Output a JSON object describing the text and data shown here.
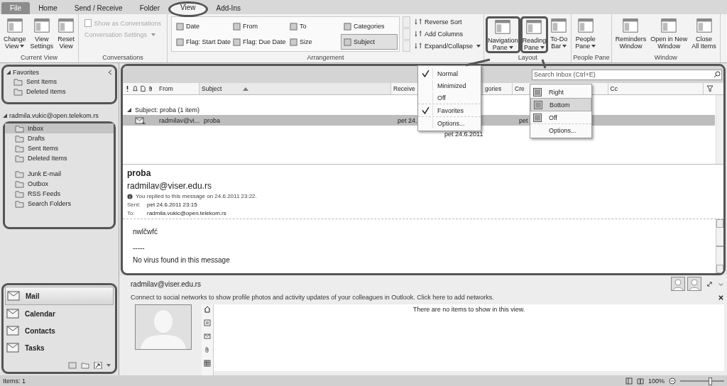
{
  "tabs": [
    {
      "label": "File",
      "kind": "file",
      "selected": false,
      "annotated": false
    },
    {
      "label": "Home",
      "kind": "tab",
      "selected": false,
      "annotated": false
    },
    {
      "label": "Send / Receive",
      "kind": "tab",
      "selected": false,
      "annotated": false
    },
    {
      "label": "Folder",
      "kind": "tab",
      "selected": false,
      "annotated": false
    },
    {
      "label": "View",
      "kind": "tab",
      "selected": true,
      "annotated": true
    },
    {
      "label": "Add-Ins",
      "kind": "tab",
      "selected": false,
      "annotated": false
    }
  ],
  "ribbon": {
    "groups": [
      {
        "kind": "buttons",
        "title": "Current View",
        "buttons": [
          {
            "lines": [
              "Change",
              "View"
            ],
            "dropdown": true,
            "annotated": false
          },
          {
            "lines": [
              "View",
              "Settings"
            ],
            "dropdown": false,
            "annotated": false
          },
          {
            "lines": [
              "Reset",
              "View"
            ],
            "dropdown": false,
            "annotated": false
          }
        ]
      },
      {
        "kind": "conversations",
        "title": "Conversations",
        "items": [
          {
            "kind": "checkbox",
            "label": "Show as Conversations",
            "checked": false,
            "disabled": true
          },
          {
            "kind": "menu",
            "label": "Conversation Settings",
            "disabled": true
          }
        ]
      },
      {
        "kind": "arrangement",
        "title": "Arrangement",
        "options": [
          {
            "label": "Date",
            "selected": false
          },
          {
            "label": "From",
            "selected": false
          },
          {
            "label": "To",
            "selected": false
          },
          {
            "label": "Categories",
            "selected": false
          },
          {
            "label": "Flag: Start Date",
            "selected": false
          },
          {
            "label": "Flag: Due Date",
            "selected": false
          },
          {
            "label": "Size",
            "selected": false
          },
          {
            "label": "Subject",
            "selected": true
          }
        ],
        "commands": [
          {
            "label": "Reverse Sort",
            "dropdown": false
          },
          {
            "label": "Add Columns",
            "dropdown": false
          },
          {
            "label": "Expand/Collapse",
            "dropdown": true
          }
        ]
      },
      {
        "kind": "buttons",
        "title": "Layout",
        "buttons": [
          {
            "lines": [
              "Navigation",
              "Pane"
            ],
            "dropdown": true,
            "annotated": true
          },
          {
            "lines": [
              "Reading",
              "Pane"
            ],
            "dropdown": true,
            "annotated": true
          },
          {
            "lines": [
              "To-Do",
              "Bar"
            ],
            "dropdown": true,
            "annotated": false
          }
        ]
      },
      {
        "kind": "buttons",
        "title": "People Pane",
        "buttons": [
          {
            "lines": [
              "People",
              "Pane"
            ],
            "dropdown": true,
            "annotated": false
          }
        ]
      },
      {
        "kind": "buttons",
        "title": "Window",
        "buttons": [
          {
            "lines": [
              "Reminders",
              "Window"
            ],
            "dropdown": false,
            "annotated": false
          },
          {
            "lines": [
              "Open in New",
              "Window"
            ],
            "dropdown": false,
            "annotated": false
          },
          {
            "lines": [
              "Close",
              "All Items"
            ],
            "dropdown": false,
            "annotated": false
          }
        ]
      }
    ]
  },
  "navigation": {
    "favorites": {
      "title": "Favorites",
      "expanded": true,
      "annotated": true,
      "items": [
        {
          "label": "Sent Items",
          "selected": false
        },
        {
          "label": "Deleted Items",
          "selected": false
        }
      ]
    },
    "account": {
      "title": "radmila.vukic@open.telekom.rs",
      "expanded": true,
      "annotated": true,
      "folders": [
        {
          "label": "Inbox",
          "selected": true
        },
        {
          "label": "Drafts",
          "selected": false
        },
        {
          "label": "Sent Items",
          "selected": false
        },
        {
          "label": "Deleted Items",
          "selected": false
        },
        {
          "label": "Junk E-mail",
          "selected": false
        },
        {
          "label": "Outbox",
          "selected": false
        },
        {
          "label": "RSS Feeds",
          "selected": false
        },
        {
          "label": "Search Folders",
          "selected": false
        }
      ]
    },
    "modules": {
      "annotated": true,
      "items": [
        {
          "label": "Mail",
          "selected": true
        },
        {
          "label": "Calendar",
          "selected": false
        },
        {
          "label": "Contacts",
          "selected": false
        },
        {
          "label": "Tasks",
          "selected": false
        }
      ]
    }
  },
  "message_list": {
    "annotated": true,
    "search": {
      "placeholder": "Search Inbox (Ctrl+E)"
    },
    "columns": [
      {
        "label": "From",
        "sorted": false
      },
      {
        "label": "Subject",
        "sorted": true
      },
      {
        "label": "Receive",
        "sorted": false
      },
      {
        "label": "gories",
        "sorted": false
      },
      {
        "label": "Cre",
        "sorted": false
      },
      {
        "label": "Cc",
        "sorted": false
      }
    ],
    "group": {
      "label": "Subject: proba (1 item)",
      "expanded": true
    },
    "rows": [
      {
        "from": "radmilav@vi...",
        "subject": "proba",
        "received": "pet 24.",
        "created": "pet",
        "selected": true,
        "replied": true
      }
    ],
    "tooltip": "pet 24.6.2011"
  },
  "reading_pane": {
    "subject": "proba",
    "from": "radmilav@viser.edu.rs",
    "info": "You replied to this message on 24.6.2011 23:22.",
    "sent_label": "Sent:",
    "sent": "pet 24.6.2011 23:15",
    "to_label": "To:",
    "to": "radmila.vukic@open.telekom.rs",
    "body": [
      "nwlčwfć",
      "-----",
      "No virus found in this message"
    ]
  },
  "people_pane": {
    "name": "radmilav@viser.edu.rs",
    "notice": "Connect to social networks to show profile photos and activity updates of your colleagues in Outlook. Click here to add networks.",
    "empty": "There are no items to show in this view."
  },
  "navigation_pane_menu": {
    "items": [
      {
        "label": "Normal",
        "checked": true,
        "separator_before": false
      },
      {
        "label": "Minimized",
        "checked": false,
        "separator_before": false
      },
      {
        "label": "Off",
        "checked": false,
        "separator_before": false
      },
      {
        "label": "Favorites",
        "checked": true,
        "separator_before": true
      },
      {
        "label": "Options...",
        "checked": false,
        "separator_before": true
      }
    ]
  },
  "reading_pane_menu": {
    "items": [
      {
        "label": "Right",
        "selected": false,
        "kind": "option",
        "separator_before": false
      },
      {
        "label": "Bottom",
        "selected": true,
        "kind": "option",
        "separator_before": false
      },
      {
        "label": "Off",
        "selected": false,
        "kind": "option",
        "separator_before": false
      },
      {
        "label": "Options...",
        "selected": false,
        "kind": "command",
        "separator_before": true
      }
    ]
  },
  "status_bar": {
    "items": "Items: 1",
    "zoom": "100%",
    "level": 0.7
  }
}
